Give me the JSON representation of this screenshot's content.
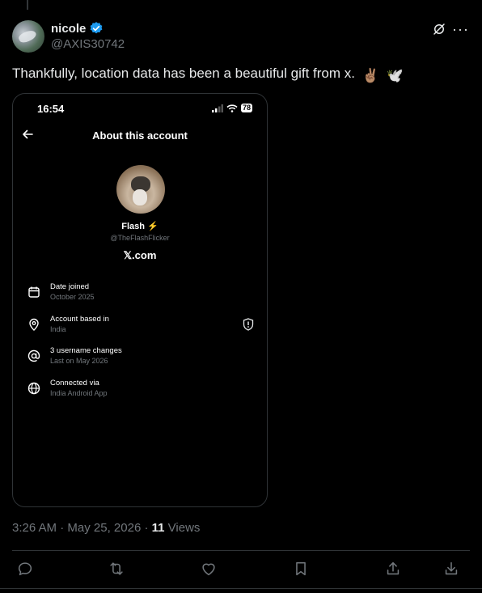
{
  "tweet": {
    "display_name": "nicole",
    "handle": "@AXIS30742",
    "text": "Thankfully, location data has been a beautiful gift from x.",
    "emojis": [
      "✌🏽",
      "🕊️"
    ],
    "time": "3:26 AM",
    "separator": " · ",
    "date": "May 25, 2026",
    "views_count": "11",
    "views_label": " Views",
    "more_icon": "···"
  },
  "screenshot": {
    "status_time": "16:54",
    "battery": "78",
    "title": "About this account",
    "profile_name": "Flash ⚡",
    "profile_handle": "@TheFlashFlicker",
    "domain": "𝕏.com",
    "rows": [
      {
        "label": "Date joined",
        "value": "October 2025",
        "icon": "calendar-icon"
      },
      {
        "label": "Account based in",
        "value": "India",
        "icon": "location-pin-icon"
      },
      {
        "label": "3 username changes",
        "value": "Last on May 2026",
        "icon": "at-sign-icon"
      },
      {
        "label": "Connected via",
        "value": "India Android App",
        "icon": "globe-icon"
      }
    ]
  },
  "colors": {
    "background": "#000000",
    "text": "#e7e9ea",
    "secondary": "#71767b",
    "verified": "#1d9bf0",
    "border": "#2f3336"
  }
}
